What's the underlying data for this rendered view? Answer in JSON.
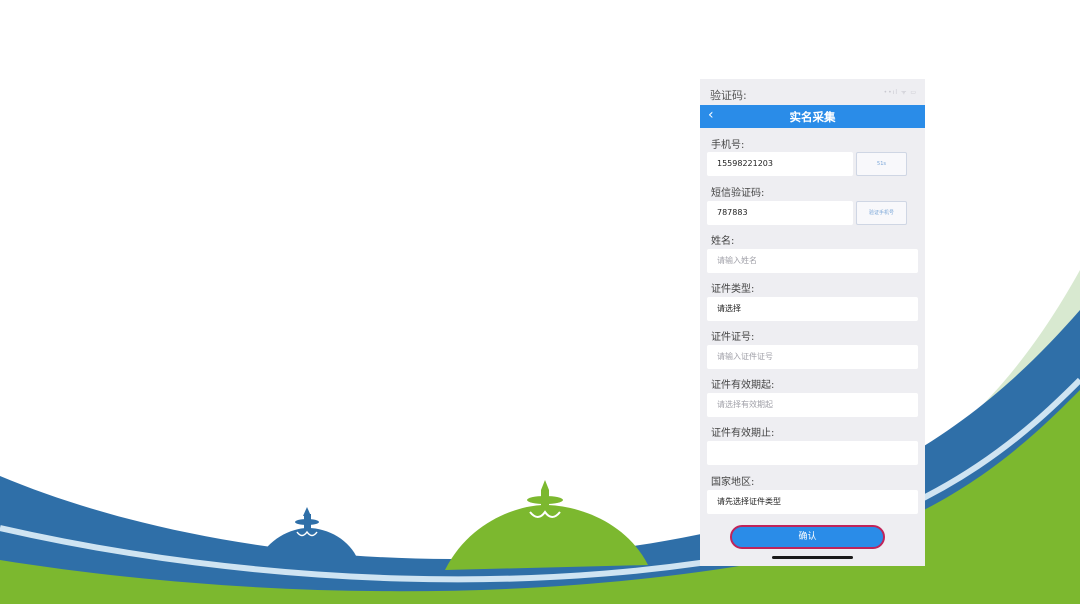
{
  "status_bar": {
    "title": "验证码:",
    "icons": "••ıl ᯤ ▭"
  },
  "nav": {
    "back_icon": "chevron-left",
    "title": "实名采集"
  },
  "form": {
    "phone_label": "手机号:",
    "phone_value": "15598221203",
    "countdown_label": "51s",
    "sms_label": "短信验证码:",
    "sms_value": "787883",
    "verify_phone_label": "验证手机号",
    "name_label": "姓名:",
    "name_placeholder": "请输入姓名",
    "id_type_label": "证件类型:",
    "id_type_value": "请选择",
    "id_number_label": "证件证号:",
    "id_number_placeholder": "请输入证件证号",
    "valid_from_label": "证件有效期起:",
    "valid_from_placeholder": "请选择有效期起",
    "valid_to_label": "证件有效期止:",
    "valid_to_value": "",
    "country_label": "国家地区:",
    "country_value": "请先选择证件类型"
  },
  "confirm_label": "确认",
  "colors": {
    "accent": "#2a8ce8",
    "confirm_border": "#c0245a",
    "landscape_green": "#7cb82f",
    "landscape_blue": "#2f6fa8"
  }
}
